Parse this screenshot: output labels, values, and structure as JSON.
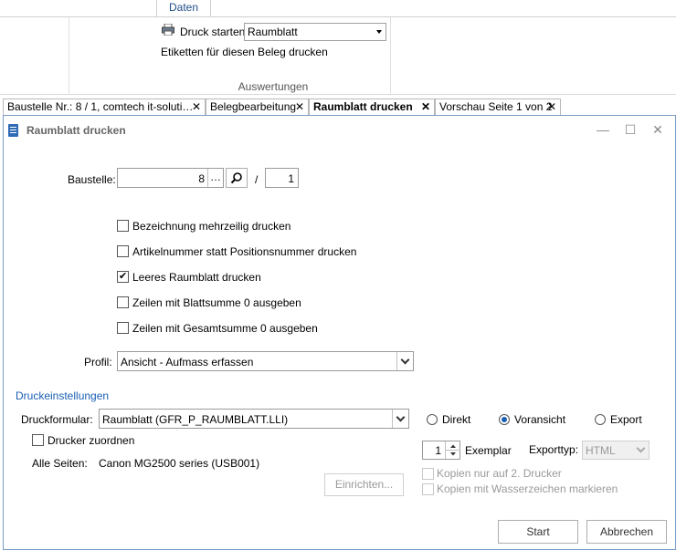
{
  "ribbon": {
    "tab_label": "Daten",
    "print_label": "Druck starten",
    "print_select_value": "Raumblatt",
    "labels_action": "Etiketten für diesen Beleg drucken",
    "group_label": "Auswertungen"
  },
  "doc_tabs": [
    {
      "label": "Baustelle Nr.: 8 / 1, comtech it-soluti…",
      "close": "✕"
    },
    {
      "label": "Belegbearbeitung",
      "close": "✕"
    },
    {
      "label": "Raumblatt drucken",
      "close": "✕"
    },
    {
      "label": "Vorschau Seite 1 von 2",
      "close": "✕"
    }
  ],
  "dialog": {
    "title": "Raumblatt drucken",
    "minimize": "—",
    "maximize": "☐",
    "close": "✕",
    "baustelle_label": "Baustelle:",
    "baustelle_value": "8",
    "ellipsis": "…",
    "slash": "/",
    "baustelle_sub_value": "1",
    "options": [
      {
        "label": "Bezeichnung mehrzeilig drucken",
        "checked": false
      },
      {
        "label": "Artikelnummer statt Positionsnummer drucken",
        "checked": false
      },
      {
        "label": "Leeres Raumblatt drucken",
        "checked": true
      },
      {
        "label": "Zeilen mit Blattsumme 0 ausgeben",
        "checked": false
      },
      {
        "label": "Zeilen mit Gesamtsumme 0 ausgeben",
        "checked": false
      }
    ],
    "profil_label": "Profil:",
    "profil_value": "Ansicht - Aufmass erfassen",
    "section_title": "Druckeinstellungen",
    "druckformular_label": "Druckformular:",
    "druckformular_value": "Raumblatt (GFR_P_RAUMBLATT.LLI)",
    "drucker_zuordnen": "Drucker zuordnen",
    "alle_seiten_label": "Alle Seiten:",
    "alle_seiten_value": "Canon MG2500 series (USB001)",
    "einrichten": "Einrichten...",
    "output_modes": [
      {
        "label": "Direkt",
        "checked": false
      },
      {
        "label": "Voransicht",
        "checked": true
      },
      {
        "label": "Export",
        "checked": false
      }
    ],
    "exemplar_value": "1",
    "exemplar_label": "Exemplar",
    "exporttyp_label": "Exporttyp:",
    "exporttyp_value": "HTML",
    "kopien_2_drucker": "Kopien nur auf 2. Drucker",
    "kopien_wasserzeichen": "Kopien mit Wasserzeichen markieren",
    "start": "Start",
    "abbrechen": "Abbrechen"
  },
  "colors": {
    "accent": "#1a5fb4",
    "border": "#7a9cc6"
  }
}
